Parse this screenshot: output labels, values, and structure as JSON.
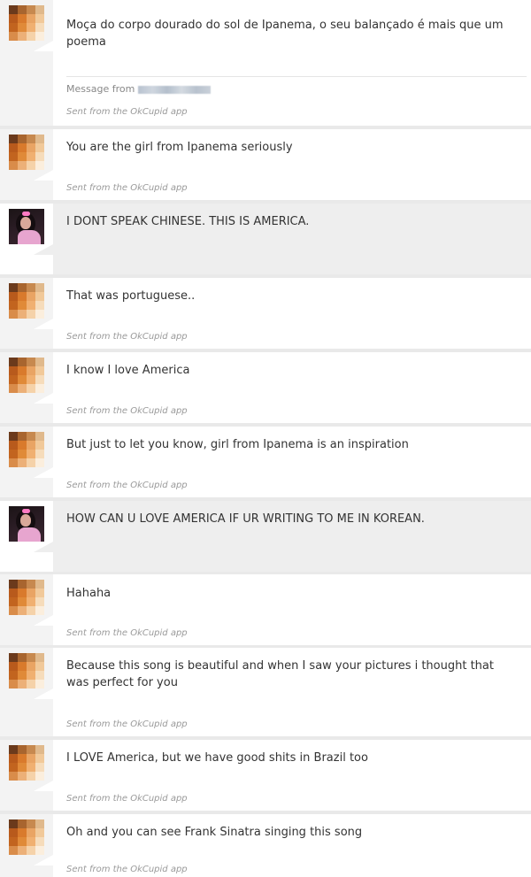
{
  "messages": [
    {
      "sender": "me",
      "text": "Moça do corpo dourado do sol de Ipanema, o seu balançado é mais que um poema",
      "message_from_label": "Message from",
      "sent": "Sent from the OkCupid app"
    },
    {
      "sender": "me",
      "text": "You are the girl from Ipanema seriously",
      "sent": "Sent from the OkCupid app"
    },
    {
      "sender": "them",
      "text": "I DONT SPEAK CHINESE. THIS IS AMERICA."
    },
    {
      "sender": "me",
      "text": "That was portuguese..",
      "sent": "Sent from the OkCupid app"
    },
    {
      "sender": "me",
      "text": "I know I love America",
      "sent": "Sent from the OkCupid app"
    },
    {
      "sender": "me",
      "text": "But just to let you know, girl from Ipanema is an inspiration",
      "sent": "Sent from the OkCupid app"
    },
    {
      "sender": "them",
      "text": "HOW CAN U LOVE AMERICA IF UR WRITING TO ME IN KOREAN."
    },
    {
      "sender": "me",
      "text": "Hahaha",
      "sent": "Sent from the OkCupid app"
    },
    {
      "sender": "me",
      "text": "Because this song is beautiful and when I saw your pictures i thought that was perfect for you",
      "sent": "Sent from the OkCupid app"
    },
    {
      "sender": "me",
      "text": "I LOVE America, but we have good shits in Brazil too",
      "sent": "Sent from the OkCupid app"
    },
    {
      "sender": "me",
      "text": "Oh and you can see Frank Sinatra singing this song",
      "sent": "Sent from the OkCupid app"
    }
  ],
  "avatar_me_pixels": [
    "#6b3a1c",
    "#a8652f",
    "#c7894f",
    "#e0b98c",
    "#b85a1c",
    "#d97a2c",
    "#e9a464",
    "#f1c99a",
    "#c2641f",
    "#e08a38",
    "#f0b071",
    "#f6dcbb",
    "#d98c4a",
    "#ecb078",
    "#f5d2a9",
    "#fbeedd"
  ],
  "colors": {
    "page_bg": "#e9e9e9",
    "bubble_me": "#ffffff",
    "bubble_them": "#eeeeee",
    "text": "#333333",
    "meta": "#9a9a9a"
  }
}
